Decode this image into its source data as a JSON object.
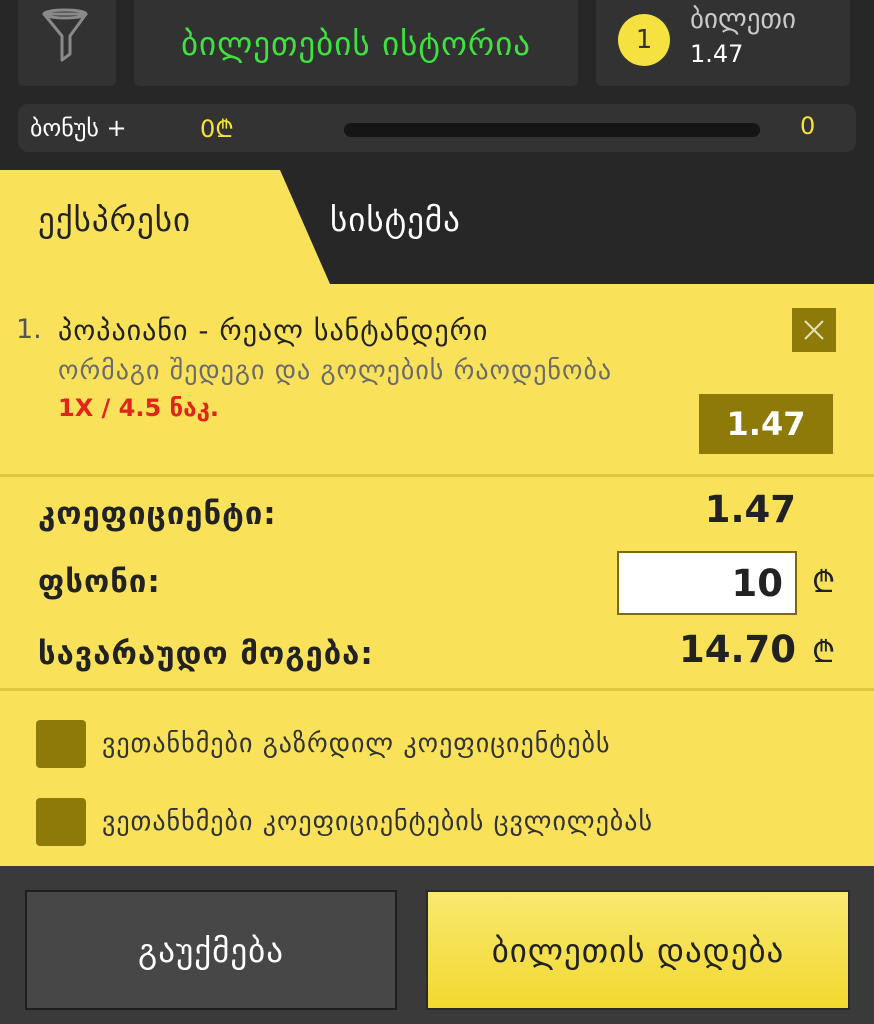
{
  "header": {
    "filter_icon": "filter-funnel-icon",
    "history_title": "ბილეთების ისტორია",
    "ticket_count": "1",
    "ticket_label": "ბილეთი",
    "ticket_odds": "1.47"
  },
  "bonus": {
    "label": "ბონუს +",
    "amount": "0₾",
    "progress": 0,
    "count": "0"
  },
  "tabs": [
    {
      "label": "ექსპრესი",
      "active": true
    },
    {
      "label": "სისტემა",
      "active": false
    }
  ],
  "bet": {
    "number": "1.",
    "event": "პოპაიანი - რეალ სანტანდერი",
    "market": "ორმაგი შედეგი და გოლების რაოდენობა",
    "pick": "1X / 4.5 ნაკ.",
    "odds": "1.47",
    "remove_icon": "close-icon"
  },
  "summary": {
    "coefficient_label": "კოეფიციენტი:",
    "coefficient_value": "1.47",
    "stake_label": "ფსონი:",
    "stake_value": "10",
    "currency": "₾",
    "win_label": "სავარაუდო მოგება:",
    "win_value": "14.70"
  },
  "options": [
    {
      "label": "ვეთანხმები გაზრდილ კოეფიციენტებს"
    },
    {
      "label": "ვეთანხმები კოეფიციენტების ცვლილებას"
    }
  ],
  "buttons": {
    "cancel": "გაუქმება",
    "place": "ბილეთის დადება"
  },
  "colors": {
    "accent_yellow": "#f9e25a",
    "dark_olive": "#8e7a09",
    "green_title": "#3ee23e",
    "red_pick": "#e0251a"
  }
}
